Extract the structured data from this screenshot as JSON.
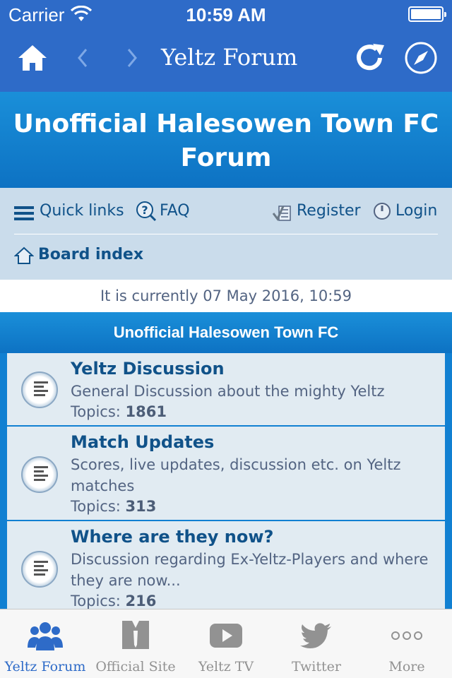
{
  "status_bar": {
    "carrier": "Carrier",
    "time": "10:59 AM"
  },
  "navbar": {
    "title": "Yeltz Forum"
  },
  "forum": {
    "title": "Unofficial Halesowen Town FC Forum",
    "links": {
      "quick_links": "Quick links",
      "faq": "FAQ",
      "register": "Register",
      "login": "Login",
      "board_index": "Board index"
    },
    "current_time": "It is currently 07 May 2016, 10:59",
    "category": "Unofficial Halesowen Town FC",
    "forums": [
      {
        "name": "Yeltz Discussion",
        "description": "General Discussion about the mighty Yeltz",
        "topics_label": "Topics:",
        "topics": "1861"
      },
      {
        "name": "Match Updates",
        "description": "Scores, live updates, discussion etc. on Yeltz matches",
        "topics_label": "Topics:",
        "topics": "313"
      },
      {
        "name": "Where are they now?",
        "description": "Discussion regarding Ex-Yeltz-Players and where they are now...",
        "topics_label": "Topics:",
        "topics": "216"
      }
    ]
  },
  "tabbar": {
    "items": [
      {
        "label": "Yeltz Forum",
        "icon": "group-icon",
        "active": true
      },
      {
        "label": "Official Site",
        "icon": "shirt-icon",
        "active": false
      },
      {
        "label": "Yeltz TV",
        "icon": "play-icon",
        "active": false
      },
      {
        "label": "Twitter",
        "icon": "twitter-bird-icon",
        "active": false
      },
      {
        "label": "More",
        "icon": "more-dots-icon",
        "active": false
      }
    ]
  },
  "colors": {
    "nav": "#2e6bc8",
    "header": "#0d72c3",
    "link": "#105289",
    "text": "#536482",
    "row": "#e1ebf2"
  }
}
